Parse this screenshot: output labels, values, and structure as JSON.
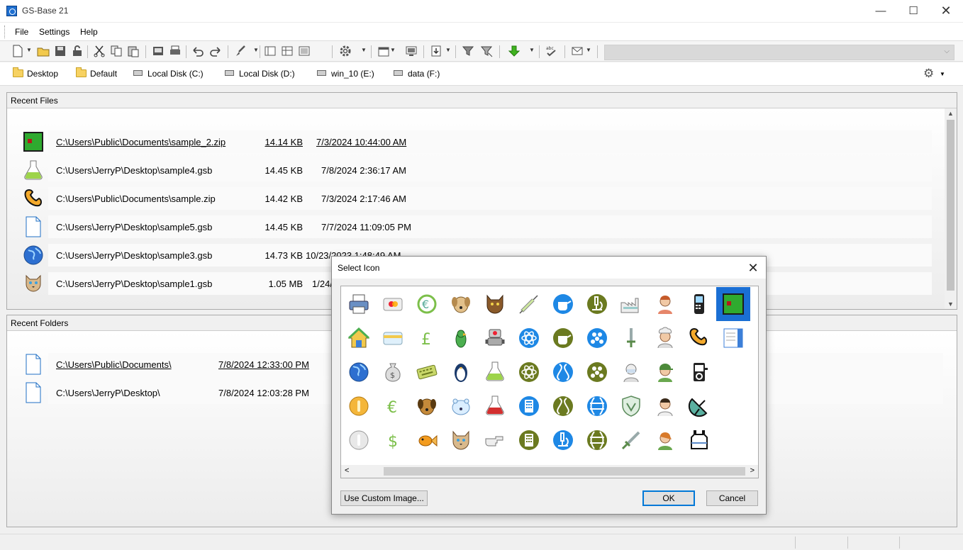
{
  "window": {
    "title": "GS-Base 21",
    "minimize": "—",
    "maximize": "☐",
    "close": "✕"
  },
  "menu": {
    "items": [
      "File",
      "Settings",
      "Help"
    ]
  },
  "toolbar": {
    "buttons": [
      "new-icon",
      "open-icon",
      "save-icon",
      "lock-icon",
      "cut-icon",
      "copy-icon",
      "paste-icon",
      "print-preview-icon",
      "print-icon",
      "undo-icon",
      "redo-icon",
      "brush-icon",
      "layout-1-icon",
      "layout-2-icon",
      "layout-3-icon",
      "moon-icon",
      "gear-icon",
      "calendar-icon",
      "screen-icon",
      "import-icon",
      "filter-icon",
      "filter-clear-icon",
      "download-icon",
      "spellcheck-icon",
      "mail-icon"
    ],
    "combo_value": ""
  },
  "locations": [
    {
      "label": "Desktop",
      "kind": "folder"
    },
    {
      "label": "Default",
      "kind": "folder"
    },
    {
      "label": "Local Disk (C:)",
      "kind": "drive"
    },
    {
      "label": "Local Disk (D:)",
      "kind": "drive"
    },
    {
      "label": "win_10 (E:)",
      "kind": "drive"
    },
    {
      "label": "data (F:)",
      "kind": "drive"
    }
  ],
  "recent_files": {
    "title": "Recent Files",
    "rows": [
      {
        "path": "C:\\Users\\Public\\Documents\\sample_2.zip",
        "size": "14.14 KB",
        "date": "7/3/2024 10:44:00 AM",
        "icon": "green-screen-icon",
        "underline": true
      },
      {
        "path": "C:\\Users\\JerryP\\Desktop\\sample4.gsb",
        "size": "14.45 KB",
        "date": "7/8/2024 2:36:17 AM",
        "icon": "flask-icon",
        "underline": false
      },
      {
        "path": "C:\\Users\\Public\\Documents\\sample.zip",
        "size": "14.42 KB",
        "date": "7/3/2024 2:17:46 AM",
        "icon": "phone-handset-icon",
        "underline": false
      },
      {
        "path": "C:\\Users\\JerryP\\Desktop\\sample5.gsb",
        "size": "14.45 KB",
        "date": "7/7/2024 11:09:05 PM",
        "icon": "document-icon",
        "underline": false
      },
      {
        "path": "C:\\Users\\JerryP\\Desktop\\sample3.gsb",
        "size": "14.73 KB",
        "date": "10/23/2023 1:48:49 AM",
        "icon": "globe-icon",
        "underline": false
      },
      {
        "path": "C:\\Users\\JerryP\\Desktop\\sample1.gsb",
        "size": "1.05 MB",
        "date": "1/24/",
        "icon": "cat-icon",
        "underline": false
      }
    ]
  },
  "recent_folders": {
    "title": "Recent Folders",
    "rows": [
      {
        "path": "C:\\Users\\Public\\Documents\\",
        "date": "7/8/2024 12:33:00 PM",
        "underline": true
      },
      {
        "path": "C:\\Users\\JerryP\\Desktop\\",
        "date": "7/8/2024 12:03:28 PM",
        "underline": false
      }
    ]
  },
  "dialog": {
    "title": "Select Icon",
    "custom_button": "Use Custom Image...",
    "ok": "OK",
    "cancel": "Cancel",
    "selected_icon": "green-screen-icon",
    "icons": [
      [
        "printer-icon",
        "credit-card-icon",
        "euro-icon",
        "dog-icon",
        "brown-cat-icon",
        "syringe-icon",
        "blue-kettle-icon",
        "olive-microscope-icon",
        "factory-icon",
        "woman-icon",
        "mobile-phone-icon",
        "green-screen-icon"
      ],
      [
        "house-icon",
        "card-icon",
        "pound-icon",
        "parrot-icon",
        "robot-icon",
        "blue-atom-icon",
        "olive-kettle-icon",
        "blue-molecule-icon",
        "sword-icon",
        "chef-icon",
        "phone-handset-icon",
        "document-panel-icon"
      ],
      [
        "globe-icon",
        "money-bag-icon",
        "keyboard-icon",
        "penguin-icon",
        "flask-icon",
        "olive-atom-icon",
        "blue-dna-icon",
        "olive-molecule-icon",
        "dentist-icon",
        "man-cap-icon",
        "media-player-icon",
        ""
      ],
      [
        "coin-icon",
        "euro-outline-icon",
        "puppy-icon",
        "polar-bear-icon",
        "red-flask-icon",
        "blue-calculator-icon",
        "olive-dna-icon",
        "blue-sphere-icon",
        "shield-icon",
        "nurse-icon",
        "satellite-dish-icon",
        ""
      ],
      [
        "silver-coin-icon",
        "dollar-icon",
        "goldfish-icon",
        "siamese-cat-icon",
        "pointing-hand-icon",
        "olive-calculator-icon",
        "blue-microscope-icon",
        "olive-sphere-icon",
        "dagger-icon",
        "girl-icon",
        "bag-icon",
        ""
      ]
    ]
  },
  "colors": {
    "selection": "#1a6fd4",
    "blue": "#1e88e5",
    "olive": "#6b7a20"
  }
}
